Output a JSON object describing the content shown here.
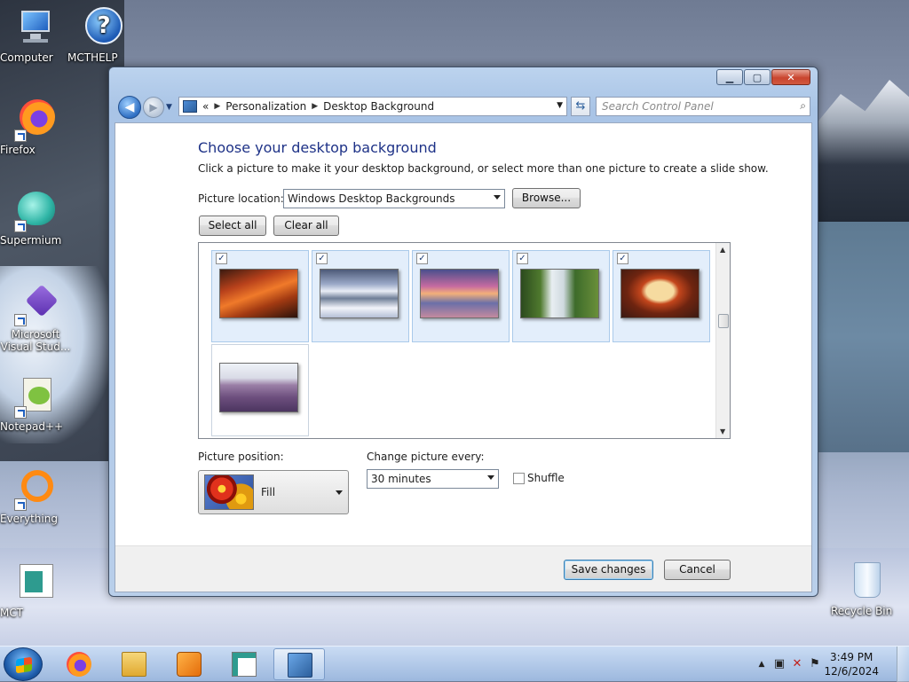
{
  "desktop": {
    "icons": [
      {
        "label": "Computer"
      },
      {
        "label": "MCTHELP"
      },
      {
        "label": "Firefox"
      },
      {
        "label": "Supermium"
      },
      {
        "label": "Microsoft Visual Stud..."
      },
      {
        "label": "Notepad++"
      },
      {
        "label": "Everything"
      },
      {
        "label": "MCT"
      },
      {
        "label": "Recycle Bin"
      }
    ]
  },
  "window": {
    "breadcrumb": {
      "overflow": "«",
      "items": [
        "Personalization",
        "Desktop Background"
      ]
    },
    "search_placeholder": "Search Control Panel",
    "heading": "Choose your desktop background",
    "subtext": "Click a picture to make it your desktop background, or select more than one picture to create a slide show.",
    "picture_location_label": "Picture location:",
    "picture_location_value": "Windows Desktop Backgrounds",
    "browse_label": "Browse...",
    "select_all_label": "Select all",
    "clear_all_label": "Clear all",
    "check_glyph": "✓",
    "gallery": [
      {
        "checked": true
      },
      {
        "checked": true
      },
      {
        "checked": true
      },
      {
        "checked": true
      },
      {
        "checked": true
      },
      {
        "checked": false
      }
    ],
    "picture_position_label": "Picture position:",
    "picture_position_value": "Fill",
    "change_every_label": "Change picture every:",
    "change_every_value": "30 minutes",
    "shuffle_label": "Shuffle",
    "save_label": "Save changes",
    "cancel_label": "Cancel"
  },
  "taskbar": {
    "time": "3:49 PM",
    "date": "12/6/2024"
  }
}
